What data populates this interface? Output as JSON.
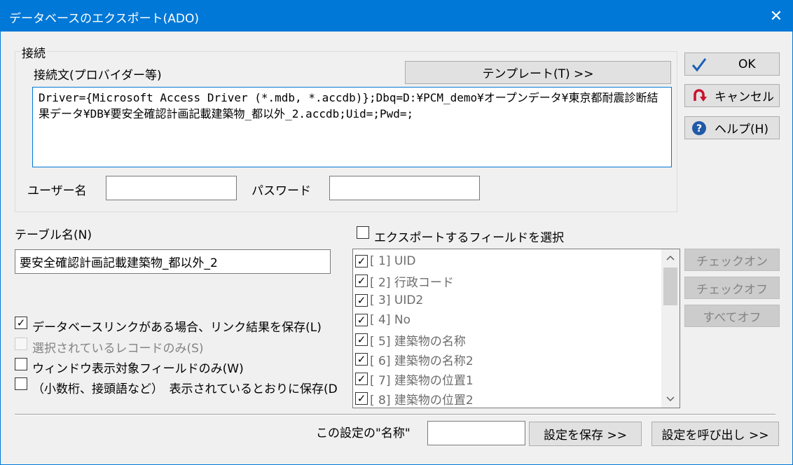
{
  "window": {
    "title": "データベースのエクスポート(ADO)",
    "close_glyph": "✕"
  },
  "connection": {
    "group_label": "接続",
    "conn_label": "接続文(プロバイダー等)",
    "template_button": "テンプレート(T) >>",
    "conn_string": "Driver={Microsoft Access Driver (*.mdb, *.accdb)};Dbq=D:¥PCM_demo¥オープンデータ¥東京都耐震診断結果データ¥DB¥要安全確認計画記載建築物_都以外_2.accdb;Uid=;Pwd=;",
    "user_label": "ユーザー名",
    "user_value": "",
    "password_label": "パスワード",
    "password_value": ""
  },
  "side_buttons": {
    "ok": "OK",
    "cancel": "キャンセル",
    "help": "ヘルプ(H)"
  },
  "table": {
    "label": "テーブル名(N)",
    "value": "要安全確認計画記載建築物_都以外_2"
  },
  "fields": {
    "select_label": "エクスポートするフィールドを選択",
    "select_checked": false,
    "items": [
      {
        "label": "[ 1] UID",
        "checked": true
      },
      {
        "label": "[ 2] 行政コード",
        "checked": true
      },
      {
        "label": "[ 3] UID2",
        "checked": true
      },
      {
        "label": "[ 4] No",
        "checked": true
      },
      {
        "label": "[ 5] 建築物の名称",
        "checked": true
      },
      {
        "label": "[ 6] 建築物の名称2",
        "checked": true
      },
      {
        "label": "[ 7] 建築物の位置1",
        "checked": true
      },
      {
        "label": "[ 8] 建築物の位置2",
        "checked": true
      }
    ],
    "check_on": "チェックオン",
    "check_off": "チェックオフ",
    "all_off": "すべてオフ"
  },
  "options": {
    "save_link": {
      "label": "データベースリンクがある場合、リンク結果を保存(L)",
      "checked": true
    },
    "selected_only": {
      "label": "選択されているレコードのみ(S)",
      "checked": false,
      "disabled": true
    },
    "window_fields": {
      "label": "ウィンドウ表示対象フィールドのみ(W)",
      "checked": false
    },
    "as_displayed": {
      "label": "（小数桁、接頭語など）　表示されているとおりに保存(D",
      "checked": false
    }
  },
  "footer": {
    "name_label": "この設定の\"名称\"",
    "name_value": "",
    "save_button": "設定を保存 >>",
    "load_button": "設定を呼び出し >>"
  },
  "colors": {
    "accent": "#0078d7",
    "ok_check": "#1a5fb4",
    "cancel_icon": "#c8102e",
    "help_icon": "#1f5aa6"
  }
}
